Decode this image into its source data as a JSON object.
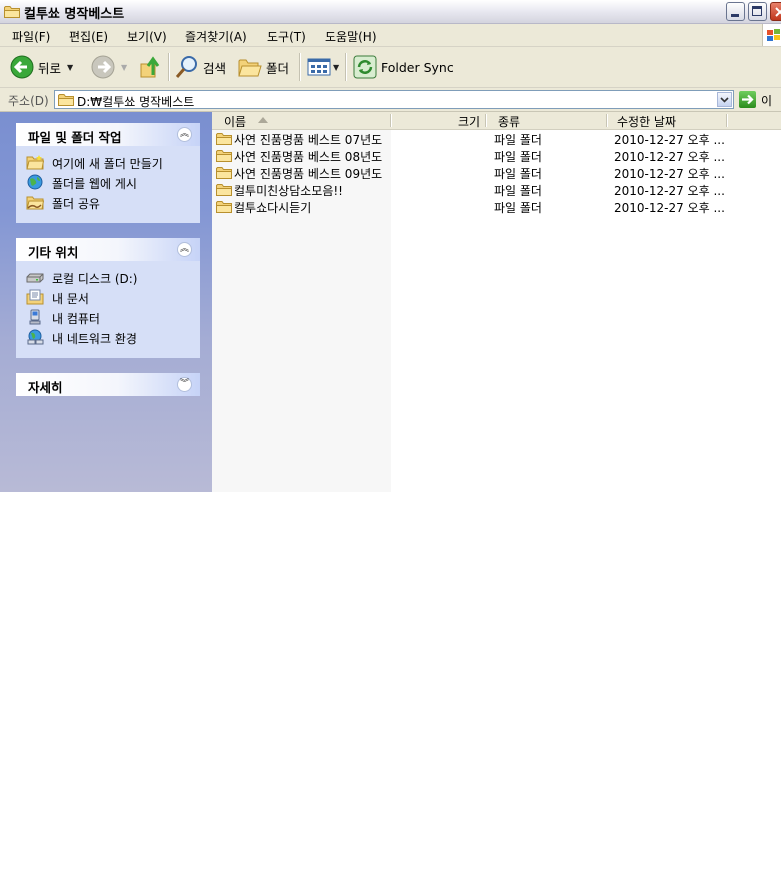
{
  "window": {
    "title": "컬투쑈 명작베스트"
  },
  "menu": [
    "파일(F)",
    "편집(E)",
    "보기(V)",
    "즐겨찾기(A)",
    "도구(T)",
    "도움말(H)"
  ],
  "toolbar": {
    "back_label": "뒤로",
    "search_label": "검색",
    "folders_label": "폴더",
    "folder_sync_label": "Folder Sync"
  },
  "address": {
    "label": "주소(D)",
    "path": "D:₩컬투쑈 명작베스트",
    "go_label": "이동"
  },
  "taskpane": {
    "file_tasks": {
      "title": "파일 및 폴더 작업",
      "items": [
        "여기에 새 폴더 만들기",
        "폴더를 웹에 게시",
        "폴더 공유"
      ]
    },
    "other_places": {
      "title": "기타 위치",
      "items": [
        "로컬 디스크 (D:)",
        "내 문서",
        "내 컴퓨터",
        "내 네트워크 환경"
      ]
    },
    "details": {
      "title": "자세히"
    }
  },
  "filelist": {
    "columns": {
      "name": "이름",
      "size": "크기",
      "type": "종류",
      "modified": "수정한 날짜"
    },
    "rows": [
      {
        "name": "사연 진품명품 베스트 07년도",
        "type": "파일 폴더",
        "modified": "2010-12-27 오후 ..."
      },
      {
        "name": "사연 진품명품 베스트 08년도",
        "type": "파일 폴더",
        "modified": "2010-12-27 오후 ..."
      },
      {
        "name": "사연 진품명품 베스트 09년도",
        "type": "파일 폴더",
        "modified": "2010-12-27 오후 ..."
      },
      {
        "name": "컬투미친상담소모음!!",
        "type": "파일 폴더",
        "modified": "2010-12-27 오후 ..."
      },
      {
        "name": "컬투쇼다시듣기",
        "type": "파일 폴더",
        "modified": "2010-12-27 오후 ..."
      }
    ]
  }
}
